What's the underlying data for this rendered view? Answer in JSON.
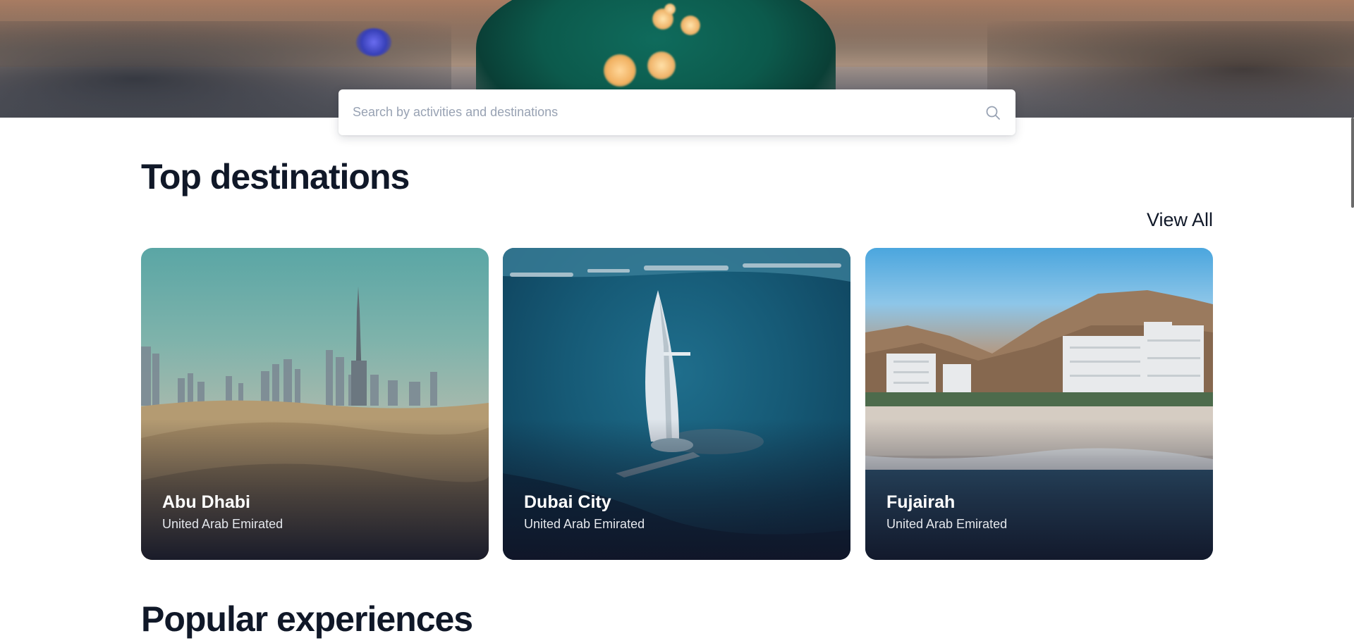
{
  "search": {
    "placeholder": "Search by activities and destinations",
    "icon": "search-icon"
  },
  "top_destinations": {
    "title": "Top destinations",
    "view_all_label": "View All",
    "cards": [
      {
        "name": "Abu Dhabi",
        "country": "United Arab Emirated"
      },
      {
        "name": "Dubai City",
        "country": "United Arab Emirated"
      },
      {
        "name": "Fujairah",
        "country": "United Arab Emirated"
      }
    ]
  },
  "popular_experiences": {
    "title": "Popular experiences"
  },
  "colors": {
    "text_primary": "#101828",
    "placeholder": "#98a2b3",
    "card_overlay": "#10142a"
  }
}
